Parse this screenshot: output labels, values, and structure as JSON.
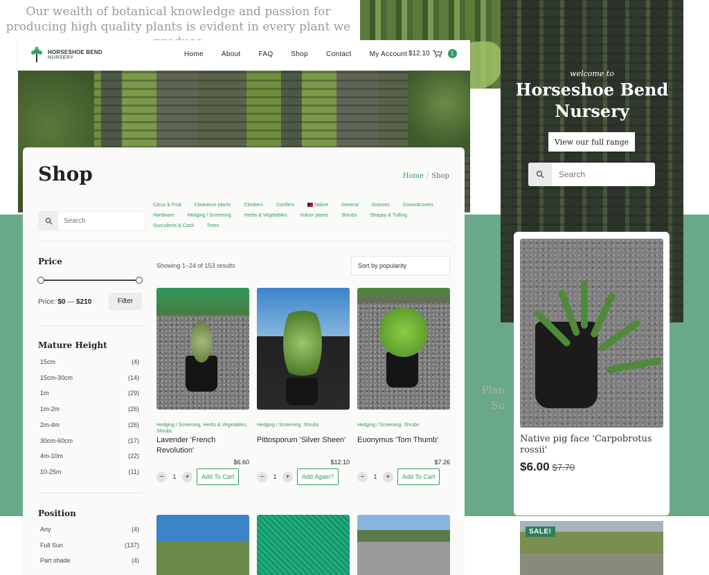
{
  "background": {
    "tagline": "Our wealth of botanical knowledge and passion for producing high quality plants is evident in every plant we produce",
    "partial_text": "Plan\nSu"
  },
  "header": {
    "brand_line1": "HORSESHOE BEND",
    "brand_line2": "NURSERY",
    "nav": [
      "Home",
      "About",
      "FAQ",
      "Shop",
      "Contact",
      "My Account"
    ],
    "cart_total": "$12.10",
    "cart_count": "1"
  },
  "shop": {
    "title": "Shop",
    "breadcrumb": {
      "home": "Home",
      "sep": "/",
      "current": "Shop"
    },
    "search_placeholder": "Search",
    "categories": [
      "Citrus & Fruit",
      "Clearance plants",
      "Climbers",
      "Conifers",
      "Native",
      "General",
      "Grasses",
      "Groundcovers",
      "Hardware",
      "Hedging / Screening",
      "Herbs & Vegetables",
      "Indoor plants",
      "Shrubs",
      "Strappy & Tufting",
      "Succulents & Cacti",
      "Trees"
    ],
    "results_text": "Showing 1–24 of 153 results",
    "sort_label": "Sort by popularity"
  },
  "sidebar": {
    "price": {
      "heading": "Price",
      "label": "Price:",
      "min": "$0",
      "dash": "—",
      "max": "$210",
      "filter": "Filter",
      "range_fraction": [
        0,
        1
      ]
    },
    "height": {
      "heading": "Mature Height",
      "items": [
        {
          "label": "15cm",
          "count": "(4)"
        },
        {
          "label": "15cm-30cm",
          "count": "(14)"
        },
        {
          "label": "1m",
          "count": "(29)"
        },
        {
          "label": "1m-2m",
          "count": "(26)"
        },
        {
          "label": "2m-4m",
          "count": "(26)"
        },
        {
          "label": "30cm-60cm",
          "count": "(17)"
        },
        {
          "label": "4m-10m",
          "count": "(22)"
        },
        {
          "label": "10-25m",
          "count": "(11)"
        }
      ]
    },
    "position": {
      "heading": "Position",
      "items": [
        {
          "label": "Any",
          "count": "(4)"
        },
        {
          "label": "Full Sun",
          "count": "(137)"
        },
        {
          "label": "Part shade",
          "count": "(4)"
        }
      ]
    }
  },
  "products": [
    {
      "category": "Hedging / Screening, Herbs & Vegetables, Shrubs",
      "name": "Lavender 'French Revolution'",
      "price": "$6.60",
      "qty": "1",
      "action": "Add To Cart"
    },
    {
      "category": "Hedging / Screening, Shrubs",
      "name": "Pittosporum 'Silver Sheen'",
      "price": "$12.10",
      "qty": "1",
      "action": "Add Again?"
    },
    {
      "category": "Hedging / Screening, Shrubs",
      "name": "Euonymus 'Tom Thumb'",
      "price": "$7.26",
      "qty": "1",
      "action": "Add To Cart"
    }
  ],
  "mobile": {
    "welcome": "welcome to",
    "title": "Horseshoe Bend Nursery",
    "range_button": "View our full range",
    "search_placeholder": "Search",
    "product": {
      "name": "Native pig face 'Carpobrotus rossii'",
      "price": "$6.00",
      "old_price": "$7.70"
    },
    "sale_badge": "SALE!"
  },
  "colors": {
    "accent": "#2e9a64",
    "band": "#6aa88a"
  }
}
